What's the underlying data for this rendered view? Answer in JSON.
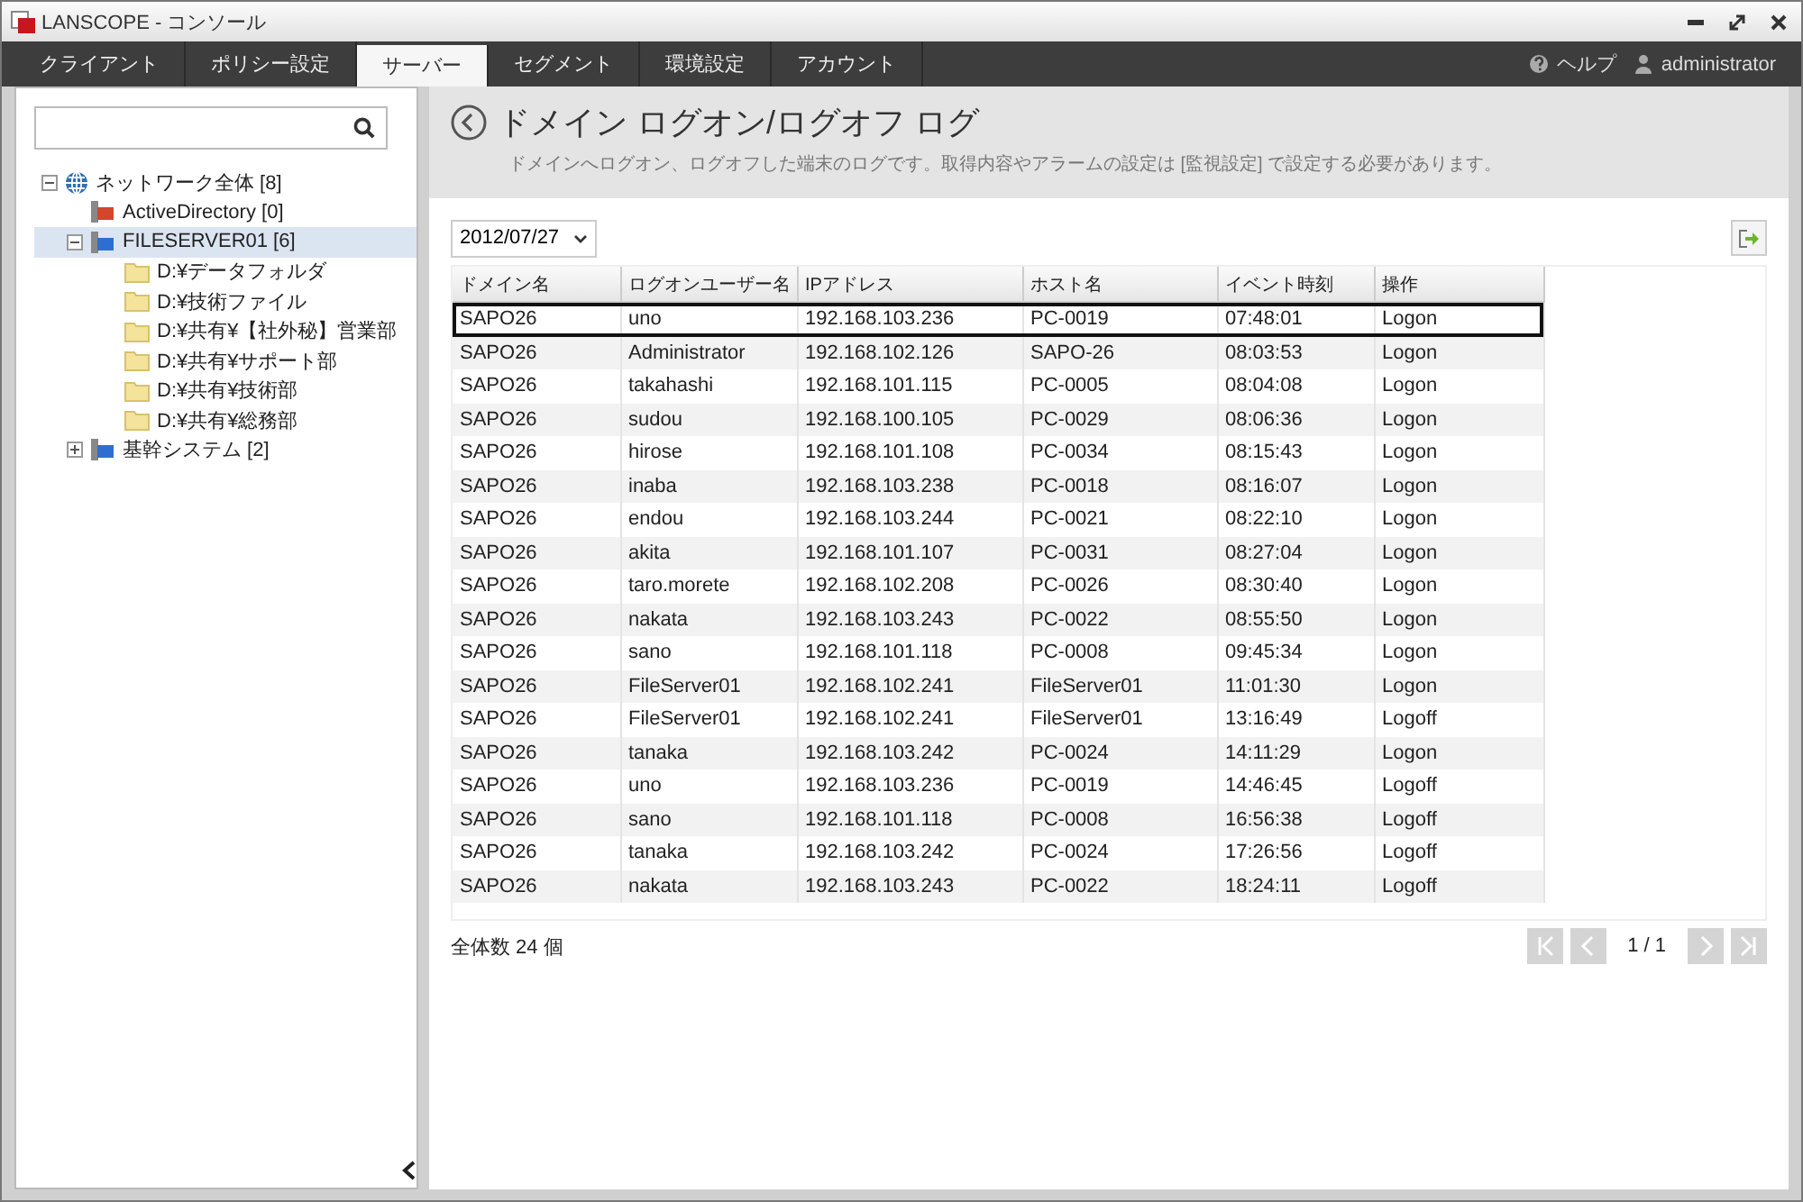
{
  "window": {
    "title": "LANSCOPE - コンソール"
  },
  "tabs": [
    {
      "label": "クライアント",
      "selected": false
    },
    {
      "label": "ポリシー設定",
      "selected": false
    },
    {
      "label": "サーバー",
      "selected": true
    },
    {
      "label": "セグメント",
      "selected": false
    },
    {
      "label": "環境設定",
      "selected": false
    },
    {
      "label": "アカウント",
      "selected": false
    }
  ],
  "help": "ヘルプ",
  "user": "administrator",
  "sidebar": {
    "tree": [
      {
        "label": "ネットワーク全体 [8]",
        "kind": "network",
        "expanded": true,
        "selected": false,
        "children": [
          {
            "label": "ActiveDirectory [0]",
            "kind": "directory",
            "selected": false
          },
          {
            "label": "FILESERVER01 [6]",
            "kind": "server",
            "expanded": true,
            "selected": true,
            "children": [
              {
                "label": "D:¥データフォルダ",
                "kind": "folder",
                "selected": false
              },
              {
                "label": "D:¥技術ファイル",
                "kind": "folder",
                "selected": false
              },
              {
                "label": "D:¥共有¥【社外秘】営業部",
                "kind": "folder",
                "selected": false
              },
              {
                "label": "D:¥共有¥サポート部",
                "kind": "folder",
                "selected": false
              },
              {
                "label": "D:¥共有¥技術部",
                "kind": "folder",
                "selected": false
              },
              {
                "label": "D:¥共有¥総務部",
                "kind": "folder",
                "selected": false
              }
            ]
          },
          {
            "label": "基幹システム [2]",
            "kind": "server",
            "expanded": false,
            "selected": false
          }
        ]
      }
    ]
  },
  "page": {
    "title": "ドメイン ログオン/ログオフ ログ",
    "description": "ドメインへログオン、ログオフした端末のログです。取得内容やアラームの設定は [監視設定] で設定する必要があります。",
    "date": "2012/07/27"
  },
  "table": {
    "columns": [
      "ドメイン名",
      "ログオンユーザー名",
      "IPアドレス",
      "ホスト名",
      "イベント時刻",
      "操作"
    ],
    "rows": [
      {
        "cells": [
          "SAPO26",
          "uno",
          "192.168.103.236",
          "PC-0019",
          "07:48:01",
          "Logon"
        ],
        "selected": true
      },
      {
        "cells": [
          "SAPO26",
          "Administrator",
          "192.168.102.126",
          "SAPO-26",
          "08:03:53",
          "Logon"
        ],
        "selected": false
      },
      {
        "cells": [
          "SAPO26",
          "takahashi",
          "192.168.101.115",
          "PC-0005",
          "08:04:08",
          "Logon"
        ],
        "selected": false
      },
      {
        "cells": [
          "SAPO26",
          "sudou",
          "192.168.100.105",
          "PC-0029",
          "08:06:36",
          "Logon"
        ],
        "selected": false
      },
      {
        "cells": [
          "SAPO26",
          "hirose",
          "192.168.101.108",
          "PC-0034",
          "08:15:43",
          "Logon"
        ],
        "selected": false
      },
      {
        "cells": [
          "SAPO26",
          "inaba",
          "192.168.103.238",
          "PC-0018",
          "08:16:07",
          "Logon"
        ],
        "selected": false
      },
      {
        "cells": [
          "SAPO26",
          "endou",
          "192.168.103.244",
          "PC-0021",
          "08:22:10",
          "Logon"
        ],
        "selected": false
      },
      {
        "cells": [
          "SAPO26",
          "akita",
          "192.168.101.107",
          "PC-0031",
          "08:27:04",
          "Logon"
        ],
        "selected": false
      },
      {
        "cells": [
          "SAPO26",
          "taro.morete",
          "192.168.102.208",
          "PC-0026",
          "08:30:40",
          "Logon"
        ],
        "selected": false
      },
      {
        "cells": [
          "SAPO26",
          "nakata",
          "192.168.103.243",
          "PC-0022",
          "08:55:50",
          "Logon"
        ],
        "selected": false
      },
      {
        "cells": [
          "SAPO26",
          "sano",
          "192.168.101.118",
          "PC-0008",
          "09:45:34",
          "Logon"
        ],
        "selected": false
      },
      {
        "cells": [
          "SAPO26",
          "FileServer01",
          "192.168.102.241",
          "FileServer01",
          "11:01:30",
          "Logon"
        ],
        "selected": false
      },
      {
        "cells": [
          "SAPO26",
          "FileServer01",
          "192.168.102.241",
          "FileServer01",
          "13:16:49",
          "Logoff"
        ],
        "selected": false
      },
      {
        "cells": [
          "SAPO26",
          "tanaka",
          "192.168.103.242",
          "PC-0024",
          "14:11:29",
          "Logon"
        ],
        "selected": false
      },
      {
        "cells": [
          "SAPO26",
          "uno",
          "192.168.103.236",
          "PC-0019",
          "14:46:45",
          "Logoff"
        ],
        "selected": false
      },
      {
        "cells": [
          "SAPO26",
          "sano",
          "192.168.101.118",
          "PC-0008",
          "16:56:38",
          "Logoff"
        ],
        "selected": false
      },
      {
        "cells": [
          "SAPO26",
          "tanaka",
          "192.168.103.242",
          "PC-0024",
          "17:26:56",
          "Logoff"
        ],
        "selected": false
      },
      {
        "cells": [
          "SAPO26",
          "nakata",
          "192.168.103.243",
          "PC-0022",
          "18:24:11",
          "Logoff"
        ],
        "selected": false
      }
    ]
  },
  "footer": {
    "total": "全体数 24 個",
    "page": "1 / 1",
    "pager": [
      {
        "kind": "first",
        "disabled": true
      },
      {
        "kind": "prev",
        "disabled": true
      },
      {
        "kind": "next",
        "disabled": true
      },
      {
        "kind": "last",
        "disabled": true
      }
    ]
  }
}
